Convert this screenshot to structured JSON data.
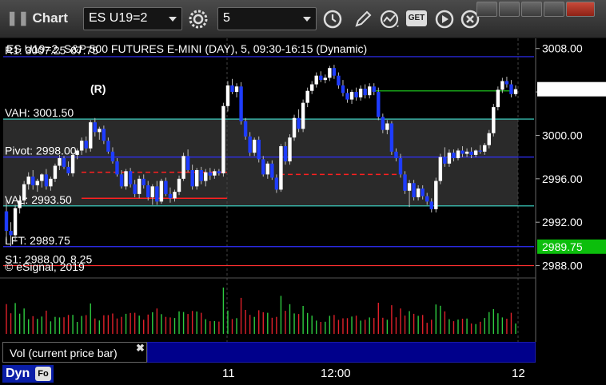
{
  "toolbar": {
    "title": "Chart",
    "symbol": "ES U19=2",
    "interval": "5",
    "get_label": "GET"
  },
  "chart_data": {
    "type": "candlestick",
    "header": "ES U19=2, S&P 500 FUTURES E-MINI (DAY), 5, 09:30-16:15 (Dynamic)",
    "copyright": "© eSignal, 2019",
    "y_ticks": [
      3008.0,
      3004.0,
      3000.0,
      2996.0,
      2992.0,
      2988.0
    ],
    "y_tick_labels": [
      "3008.00",
      "3004.00",
      "3000.00",
      "2996.00",
      "2992.00",
      "2988.00"
    ],
    "ylim": [
      2987.6,
      3008.2
    ],
    "x_tick_labels": [
      "11",
      "12:00",
      "12"
    ],
    "last_price": "3004.25",
    "levels": [
      {
        "label": "R1: 3007.25",
        "value": 3007.25,
        "color": "#3030ff",
        "extra": "07.75"
      },
      {
        "label": "VAH: 3001.50",
        "value": 3001.5,
        "color": "#40e0d0"
      },
      {
        "label": "Pivot: 2998.00",
        "value": 2998.0,
        "color": "#3030ff"
      },
      {
        "label": "VAL: 2993.50",
        "value": 2993.5,
        "color": "#40e0d0"
      },
      {
        "label": "LFT: 2989.75",
        "value": 2989.75,
        "color": "#3030ff"
      },
      {
        "label": "S1: 2988.00",
        "value": 2988.0,
        "color": "#ff3030",
        "extra": "8.25"
      }
    ],
    "lft_badge": "2989.75",
    "marker_r": "(R)",
    "candles": [
      [
        2993.0,
        2994.2,
        2990.5,
        2991.2
      ],
      [
        2991.2,
        2992.0,
        2989.8,
        2990.8
      ],
      [
        2990.8,
        2993.6,
        2990.2,
        2993.3
      ],
      [
        2993.3,
        2994.5,
        2992.8,
        2994.0
      ],
      [
        2994.0,
        2995.8,
        2993.6,
        2995.5
      ],
      [
        2995.5,
        2996.6,
        2995.0,
        2996.2
      ],
      [
        2996.2,
        2996.8,
        2995.0,
        2995.4
      ],
      [
        2995.4,
        2996.0,
        2994.8,
        2995.8
      ],
      [
        2995.8,
        2996.5,
        2995.2,
        2996.4
      ],
      [
        2996.4,
        2996.9,
        2995.0,
        2995.3
      ],
      [
        2995.3,
        2996.2,
        2994.9,
        2996.0
      ],
      [
        2996.0,
        2997.4,
        2995.7,
        2997.2
      ],
      [
        2997.2,
        2998.2,
        2996.8,
        2997.9
      ],
      [
        2997.9,
        2998.1,
        2996.9,
        2997.1
      ],
      [
        2997.1,
        2997.6,
        2996.3,
        2996.5
      ],
      [
        2996.5,
        2998.4,
        2996.2,
        2998.2
      ],
      [
        2998.2,
        2998.8,
        2997.8,
        2998.6
      ],
      [
        2998.6,
        2999.8,
        2998.2,
        2999.5
      ],
      [
        2999.5,
        2999.9,
        2998.4,
        2998.8
      ],
      [
        2998.8,
        3001.4,
        2998.5,
        3001.2
      ],
      [
        3001.2,
        3001.6,
        2999.9,
        3000.3
      ],
      [
        3000.3,
        3000.8,
        2999.6,
        3000.6
      ],
      [
        3000.6,
        3000.9,
        2999.2,
        2999.5
      ],
      [
        2999.5,
        2999.8,
        2998.3,
        2998.5
      ],
      [
        2998.5,
        2998.9,
        2997.4,
        2997.6
      ],
      [
        2997.6,
        2997.9,
        2996.2,
        2996.4
      ],
      [
        2996.4,
        2996.8,
        2995.1,
        2995.3
      ],
      [
        2995.3,
        2996.9,
        2995.0,
        2996.7
      ],
      [
        2996.7,
        2997.0,
        2995.2,
        2995.5
      ],
      [
        2995.5,
        2995.9,
        2994.3,
        2994.6
      ],
      [
        2994.6,
        2996.3,
        2994.2,
        2996.0
      ],
      [
        2996.0,
        2996.4,
        2995.1,
        2995.4
      ],
      [
        2995.4,
        2995.8,
        2994.0,
        2994.3
      ],
      [
        2994.3,
        2995.5,
        2993.6,
        2995.3
      ],
      [
        2995.3,
        2995.8,
        2993.6,
        2993.9
      ],
      [
        2993.9,
        2996.0,
        2993.7,
        2995.8
      ],
      [
        2995.8,
        2996.1,
        2994.4,
        2994.6
      ],
      [
        2994.6,
        2995.2,
        2993.8,
        2994.2
      ],
      [
        2994.2,
        2995.0,
        2993.9,
        2994.8
      ],
      [
        2994.8,
        2996.3,
        2994.5,
        2996.0
      ],
      [
        2996.0,
        2998.4,
        2995.8,
        2998.1
      ],
      [
        2998.1,
        2998.7,
        2996.6,
        2996.8
      ],
      [
        2996.8,
        2997.3,
        2995.0,
        2995.3
      ],
      [
        2995.3,
        2997.0,
        2995.0,
        2996.8
      ],
      [
        2996.8,
        2997.1,
        2995.5,
        2995.8
      ],
      [
        2995.8,
        2996.9,
        2995.3,
        2996.6
      ],
      [
        2996.6,
        2997.0,
        2995.9,
        2996.3
      ],
      [
        2996.3,
        2996.9,
        2996.0,
        2996.7
      ],
      [
        2996.7,
        2996.9,
        2996.3,
        2996.5
      ],
      [
        2996.5,
        3003.0,
        2996.2,
        3002.7
      ],
      [
        3002.7,
        3005.0,
        3002.2,
        3004.6
      ],
      [
        3004.6,
        3005.2,
        3003.8,
        3004.0
      ],
      [
        3004.0,
        3004.8,
        3003.5,
        3004.5
      ],
      [
        3004.5,
        3004.9,
        3001.0,
        3001.3
      ],
      [
        3001.3,
        3001.6,
        2999.6,
        2999.9
      ],
      [
        2999.9,
        3000.3,
        2998.1,
        2998.4
      ],
      [
        2998.4,
        2999.8,
        2998.1,
        2999.6
      ],
      [
        2999.6,
        2999.9,
        2997.5,
        2997.8
      ],
      [
        2997.8,
        2998.1,
        2996.2,
        2996.4
      ],
      [
        2996.4,
        2997.6,
        2996.0,
        2997.4
      ],
      [
        2997.4,
        2997.7,
        2995.9,
        2996.1
      ],
      [
        2996.1,
        2996.4,
        2994.7,
        2995.0
      ],
      [
        2995.0,
        2999.2,
        2994.8,
        2999.0
      ],
      [
        2999.0,
        2999.4,
        2997.3,
        2997.6
      ],
      [
        2997.6,
        3000.1,
        2997.3,
        2999.8
      ],
      [
        2999.8,
        3001.9,
        2999.5,
        3001.6
      ],
      [
        3001.6,
        3002.4,
        3000.3,
        3000.6
      ],
      [
        3000.6,
        3003.3,
        3000.3,
        3003.0
      ],
      [
        3003.0,
        3004.4,
        3002.6,
        3004.1
      ],
      [
        3004.1,
        3005.0,
        3003.8,
        3004.7
      ],
      [
        3004.7,
        3005.8,
        3004.4,
        3005.5
      ],
      [
        3005.5,
        3005.9,
        3004.9,
        3005.1
      ],
      [
        3005.1,
        3005.6,
        3004.8,
        3005.3
      ],
      [
        3005.3,
        3006.4,
        3005.0,
        3006.2
      ],
      [
        3006.2,
        3006.5,
        3005.2,
        3005.5
      ],
      [
        3005.5,
        3005.8,
        3004.3,
        3004.6
      ],
      [
        3004.6,
        3005.1,
        3003.6,
        3003.9
      ],
      [
        3003.9,
        3004.3,
        3003.0,
        3003.3
      ],
      [
        3003.3,
        3004.2,
        3002.9,
        3004.0
      ],
      [
        3004.0,
        3004.4,
        3003.2,
        3003.5
      ],
      [
        3003.5,
        3004.6,
        3003.2,
        3004.3
      ],
      [
        3004.3,
        3004.7,
        3003.4,
        3003.7
      ],
      [
        3003.7,
        3004.8,
        3003.4,
        3004.5
      ],
      [
        3004.5,
        3004.8,
        3003.7,
        3004.0
      ],
      [
        3004.0,
        3004.4,
        3001.4,
        3001.7
      ],
      [
        3001.7,
        3002.0,
        3000.2,
        3000.5
      ],
      [
        3000.5,
        3001.4,
        3000.1,
        3001.1
      ],
      [
        3001.1,
        3001.3,
        2998.2,
        2998.5
      ],
      [
        2998.5,
        2998.8,
        2997.6,
        2997.9
      ],
      [
        2997.9,
        2998.3,
        2996.1,
        2996.4
      ],
      [
        2996.4,
        2996.7,
        2994.6,
        2994.9
      ],
      [
        2994.9,
        2995.9,
        2993.4,
        2995.6
      ],
      [
        2995.6,
        2995.9,
        2994.0,
        2994.3
      ],
      [
        2994.3,
        2995.4,
        2994.0,
        2995.1
      ],
      [
        2995.1,
        2995.4,
        2994.1,
        2994.4
      ],
      [
        2994.4,
        2994.7,
        2993.6,
        2993.9
      ],
      [
        2993.9,
        2994.2,
        2992.9,
        2993.2
      ],
      [
        2993.2,
        2996.1,
        2992.9,
        2995.8
      ],
      [
        2995.8,
        2998.3,
        2995.5,
        2998.0
      ],
      [
        2998.0,
        2998.9,
        2997.1,
        2997.4
      ],
      [
        2997.4,
        2998.7,
        2997.1,
        2998.4
      ],
      [
        2998.4,
        2998.7,
        2997.6,
        2997.9
      ],
      [
        2997.9,
        2998.8,
        2997.7,
        2998.6
      ],
      [
        2998.6,
        2999.0,
        2998.0,
        2998.3
      ],
      [
        2998.3,
        2998.8,
        2998.0,
        2998.5
      ],
      [
        2998.5,
        2998.9,
        2997.9,
        2998.2
      ],
      [
        2998.2,
        2998.7,
        2998.0,
        2998.6
      ],
      [
        2998.6,
        2999.1,
        2998.3,
        2998.5
      ],
      [
        2998.5,
        2999.3,
        2998.2,
        2999.1
      ],
      [
        2999.1,
        3000.5,
        2998.8,
        3000.2
      ],
      [
        3000.2,
        3002.9,
        2999.9,
        3002.6
      ],
      [
        3002.6,
        3004.5,
        3002.3,
        3004.2
      ],
      [
        3004.2,
        3005.3,
        3003.9,
        3005.0
      ],
      [
        3005.0,
        3005.4,
        3004.4,
        3004.7
      ],
      [
        3004.7,
        3005.1,
        3003.5,
        3003.8
      ],
      [
        3003.8,
        3004.6,
        3003.6,
        3004.25
      ]
    ],
    "volume_ticks": [
      "50000",
      "0"
    ],
    "volume_last": "9138",
    "volume_study": "Vol (current price bar)"
  },
  "bottom": {
    "dyn": "Dyn",
    "dyn_icon": "Fo"
  },
  "colors": {
    "up": "#ffffff",
    "down": "#1e3cff",
    "volume_up": "#2ecc40",
    "volume_down": "#e0202a",
    "axis_bg": "#000000",
    "last_price_badge": "#ffffff",
    "lft_badge": "#0cbe0c",
    "vol_badge": "#2ad52a"
  }
}
